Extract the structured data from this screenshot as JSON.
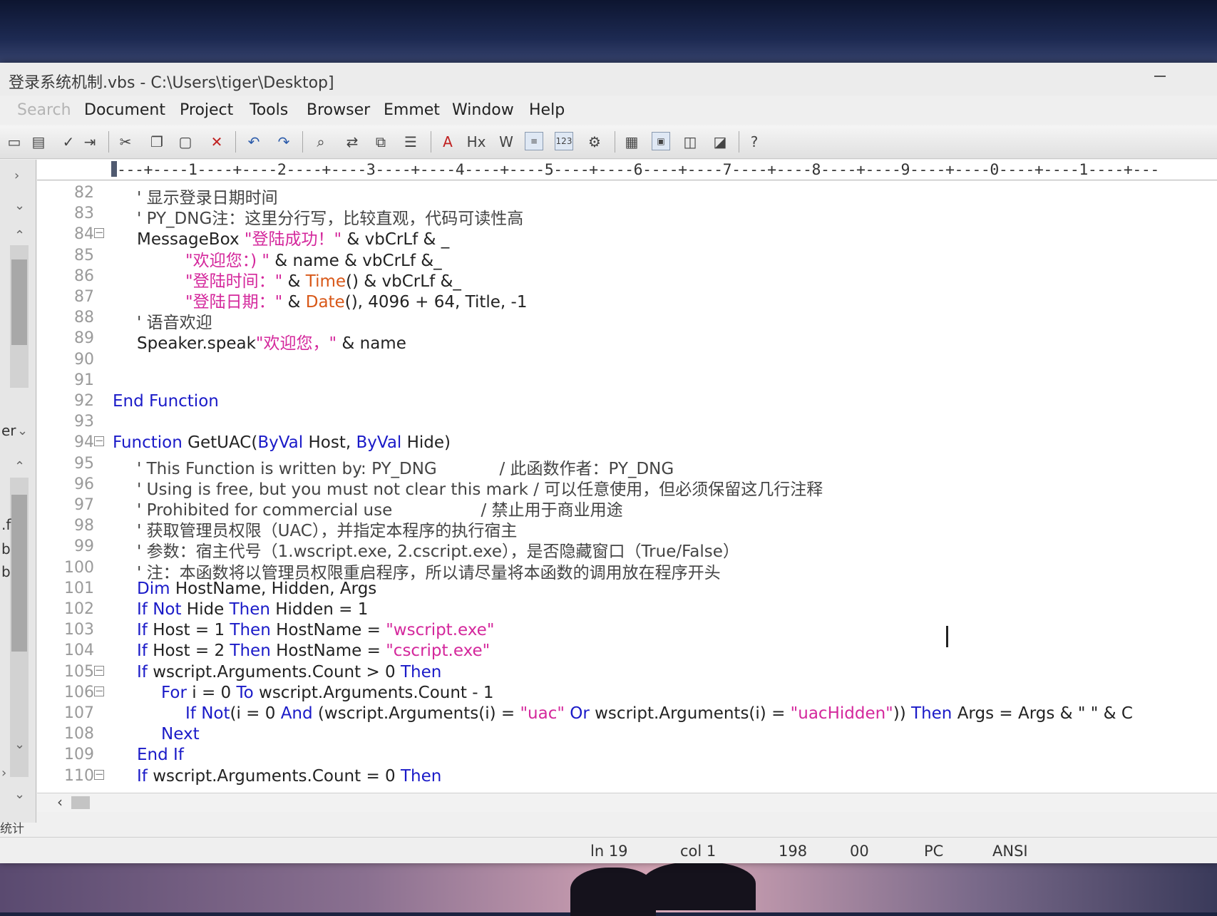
{
  "window": {
    "title": "登录系统机制.vbs - C:\\Users\\tiger\\Desktop]"
  },
  "menu": {
    "items": [
      "Search",
      "Document",
      "Project",
      "Tools",
      "Browser",
      "Emmet",
      "Window",
      "Help"
    ]
  },
  "ruler": {
    "text": "---+----1----+----2----+----3----+----4----+----5----+----6----+----7----+----8----+----9----+----0----+----1----+---"
  },
  "sidebar": {
    "fragments": [
      ".f",
      "b",
      "b",
      "er",
      "统计"
    ]
  },
  "editor": {
    "lines": [
      {
        "num": "82",
        "fold": false,
        "indent": 1,
        "parts": [
          [
            "cm",
            "' 显示登录日期时间"
          ]
        ]
      },
      {
        "num": "83",
        "fold": false,
        "indent": 1,
        "parts": [
          [
            "cm",
            "' PY_DNG注：这里分行写，比较直观，代码可读性高"
          ]
        ]
      },
      {
        "num": "84",
        "fold": true,
        "indent": 1,
        "parts": [
          [
            "op",
            "MessageBox "
          ],
          [
            "str",
            "\"登陆成功！\""
          ],
          [
            "op",
            " & vbCrLf & _"
          ]
        ]
      },
      {
        "num": "85",
        "fold": false,
        "indent": 3,
        "parts": [
          [
            "str",
            "\"欢迎您：) \""
          ],
          [
            "op",
            " & name & vbCrLf &_"
          ]
        ]
      },
      {
        "num": "86",
        "fold": false,
        "indent": 3,
        "parts": [
          [
            "str",
            "\"登陆时间：\""
          ],
          [
            "op",
            " & "
          ],
          [
            "fn",
            "Time"
          ],
          [
            "op",
            "() & vbCrLf &_"
          ]
        ]
      },
      {
        "num": "87",
        "fold": false,
        "indent": 3,
        "parts": [
          [
            "str",
            "\"登陆日期：\""
          ],
          [
            "op",
            " & "
          ],
          [
            "fn",
            "Date"
          ],
          [
            "op",
            "(), 4096 + 64, Title, -1"
          ]
        ]
      },
      {
        "num": "88",
        "fold": false,
        "indent": 1,
        "parts": [
          [
            "cm",
            "' 语音欢迎"
          ]
        ]
      },
      {
        "num": "89",
        "fold": false,
        "indent": 1,
        "parts": [
          [
            "op",
            "Speaker.speak"
          ],
          [
            "str",
            "\"欢迎您，\""
          ],
          [
            "op",
            " & name"
          ]
        ]
      },
      {
        "num": "90",
        "fold": false,
        "indent": 0,
        "parts": []
      },
      {
        "num": "91",
        "fold": false,
        "indent": 0,
        "parts": []
      },
      {
        "num": "92",
        "fold": false,
        "indent": 0,
        "parts": [
          [
            "kw",
            "End Function"
          ]
        ]
      },
      {
        "num": "93",
        "fold": false,
        "indent": 0,
        "parts": []
      },
      {
        "num": "94",
        "fold": true,
        "indent": 0,
        "parts": [
          [
            "kw",
            "Function"
          ],
          [
            "op",
            " GetUAC("
          ],
          [
            "kw",
            "ByVal"
          ],
          [
            "op",
            " Host, "
          ],
          [
            "kw",
            "ByVal"
          ],
          [
            "op",
            " Hide)"
          ]
        ]
      },
      {
        "num": "95",
        "fold": false,
        "indent": 1,
        "parts": [
          [
            "cm",
            "' This Function is written by: PY_DNG            / 此函数作者：PY_DNG"
          ]
        ]
      },
      {
        "num": "96",
        "fold": false,
        "indent": 1,
        "parts": [
          [
            "cm",
            "' Using is free, but you must not clear this mark / 可以任意使用，但必须保留这几行注释"
          ]
        ]
      },
      {
        "num": "97",
        "fold": false,
        "indent": 1,
        "parts": [
          [
            "cm",
            "' Prohibited for commercial use                 / 禁止用于商业用途"
          ]
        ]
      },
      {
        "num": "98",
        "fold": false,
        "indent": 1,
        "parts": [
          [
            "cm",
            "' 获取管理员权限（UAC），并指定本程序的执行宿主"
          ]
        ]
      },
      {
        "num": "99",
        "fold": false,
        "indent": 1,
        "parts": [
          [
            "cm",
            "' 参数：宿主代号（1.wscript.exe, 2.cscript.exe），是否隐藏窗口（True/False）"
          ]
        ]
      },
      {
        "num": "100",
        "fold": false,
        "indent": 1,
        "parts": [
          [
            "cm",
            "' 注：本函数将以管理员权限重启程序，所以请尽量将本函数的调用放在程序开头"
          ]
        ]
      },
      {
        "num": "101",
        "fold": false,
        "indent": 1,
        "parts": [
          [
            "kw",
            "Dim"
          ],
          [
            "op",
            " HostName, Hidden, Args"
          ]
        ]
      },
      {
        "num": "102",
        "fold": false,
        "indent": 1,
        "parts": [
          [
            "kw",
            "If Not"
          ],
          [
            "op",
            " Hide "
          ],
          [
            "kw",
            "Then"
          ],
          [
            "op",
            " Hidden = 1"
          ]
        ]
      },
      {
        "num": "103",
        "fold": false,
        "indent": 1,
        "parts": [
          [
            "kw",
            "If"
          ],
          [
            "op",
            " Host = 1 "
          ],
          [
            "kw",
            "Then"
          ],
          [
            "op",
            " HostName = "
          ],
          [
            "str",
            "\"wscript.exe\""
          ]
        ]
      },
      {
        "num": "104",
        "fold": false,
        "indent": 1,
        "parts": [
          [
            "kw",
            "If"
          ],
          [
            "op",
            " Host = 2 "
          ],
          [
            "kw",
            "Then"
          ],
          [
            "op",
            " HostName = "
          ],
          [
            "str",
            "\"cscript.exe\""
          ]
        ]
      },
      {
        "num": "105",
        "fold": true,
        "indent": 1,
        "parts": [
          [
            "kw",
            "If"
          ],
          [
            "op",
            " wscript.Arguments.Count > 0 "
          ],
          [
            "kw",
            "Then"
          ]
        ]
      },
      {
        "num": "106",
        "fold": true,
        "indent": 2,
        "parts": [
          [
            "kw",
            "For"
          ],
          [
            "op",
            " i = 0 "
          ],
          [
            "kw",
            "To"
          ],
          [
            "op",
            " wscript.Arguments.Count - 1"
          ]
        ]
      },
      {
        "num": "107",
        "fold": false,
        "indent": 3,
        "parts": [
          [
            "kw",
            "If Not"
          ],
          [
            "op",
            "(i = 0 "
          ],
          [
            "kw",
            "And"
          ],
          [
            "op",
            " (wscript.Arguments(i) = "
          ],
          [
            "str",
            "\"uac\""
          ],
          [
            "op",
            " "
          ],
          [
            "kw",
            "Or"
          ],
          [
            "op",
            " wscript.Arguments(i) = "
          ],
          [
            "str",
            "\"uacHidden\""
          ],
          [
            "op",
            ")) "
          ],
          [
            "kw",
            "Then"
          ],
          [
            "op",
            " Args = Args & \" \" & C"
          ]
        ]
      },
      {
        "num": "108",
        "fold": false,
        "indent": 2,
        "parts": [
          [
            "kw",
            "Next"
          ]
        ]
      },
      {
        "num": "109",
        "fold": false,
        "indent": 1,
        "parts": [
          [
            "kw",
            "End If"
          ]
        ]
      },
      {
        "num": "110",
        "fold": true,
        "indent": 1,
        "parts": [
          [
            "kw",
            "If"
          ],
          [
            "op",
            " wscript.Arguments.Count = 0 "
          ],
          [
            "kw",
            "Then"
          ]
        ]
      }
    ]
  },
  "status": {
    "line": "ln 19",
    "col": "col 1",
    "chars": "198",
    "mode": "00",
    "eol": "PC",
    "encoding": "ANSI"
  },
  "tab": {
    "label": "统计"
  },
  "icons": [
    "save-icon",
    "undo-icon",
    "redo-icon",
    "cut-icon",
    "copy-icon",
    "paste-icon",
    "delete-icon",
    "find-icon",
    "replace-icon",
    "settings-icon",
    "help-icon"
  ]
}
